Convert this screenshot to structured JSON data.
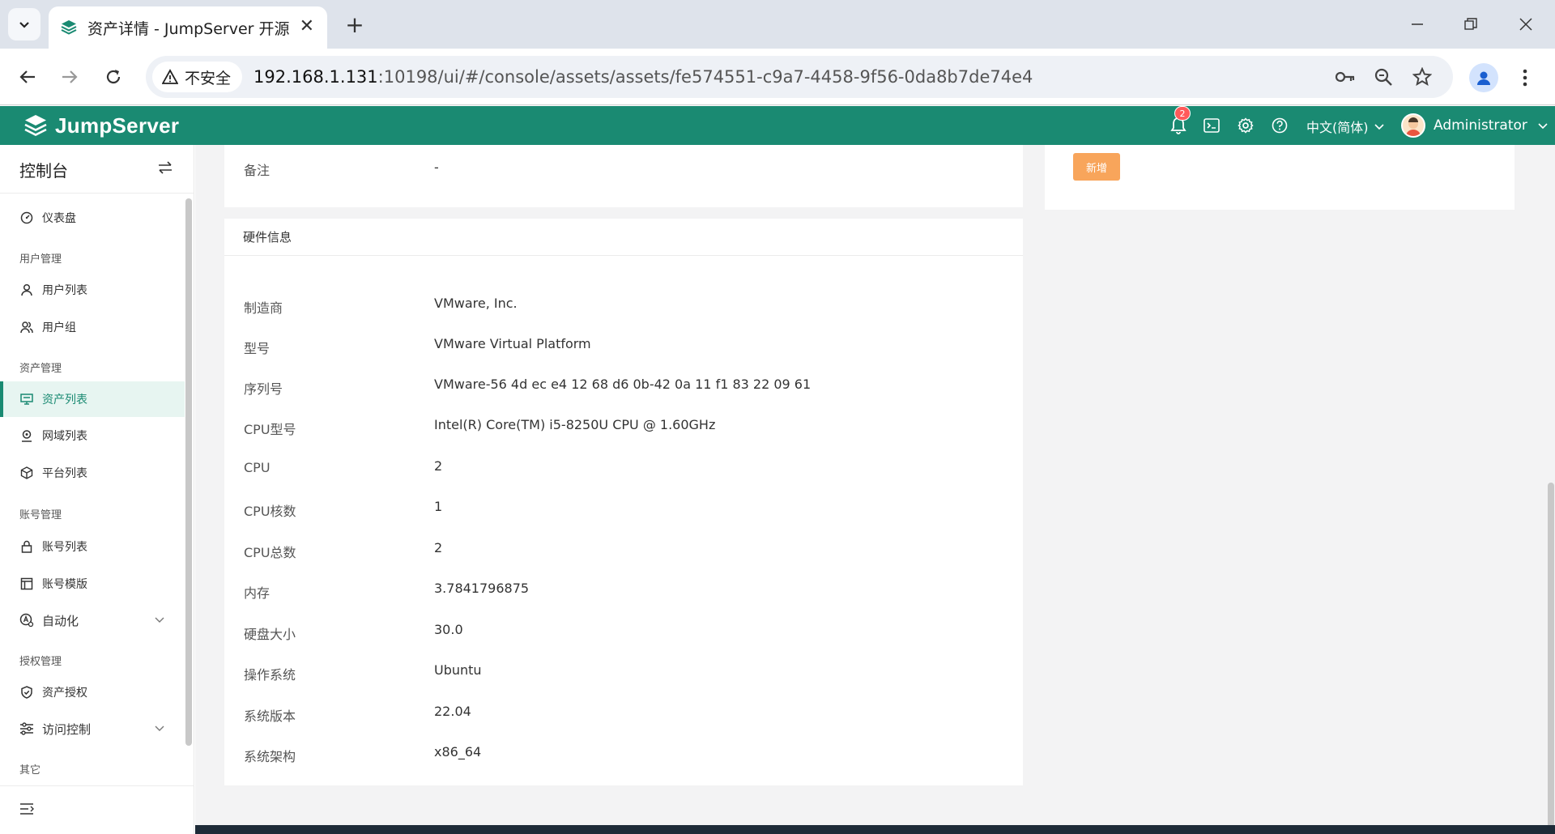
{
  "browser": {
    "tab_title": "资产详情 - JumpServer 开源堡垒机",
    "security_label": "不安全",
    "url_host": "192.168.1.131",
    "url_rest": ":10198/ui/#/console/assets/assets/fe574551-c9a7-4458-9f56-0da8b7de74e4"
  },
  "header": {
    "logo_text": "JumpServer",
    "notification_count": "2",
    "language": "中文(简体)",
    "username": "Administrator"
  },
  "sidebar": {
    "title": "控制台",
    "items": [
      {
        "label": "仪表盘",
        "icon": "dashboard-icon"
      },
      {
        "group": "用户管理"
      },
      {
        "label": "用户列表",
        "icon": "user-icon"
      },
      {
        "label": "用户组",
        "icon": "users-icon"
      },
      {
        "group": "资产管理"
      },
      {
        "label": "资产列表",
        "icon": "monitor-icon",
        "active": true
      },
      {
        "label": "网域列表",
        "icon": "location-icon"
      },
      {
        "label": "平台列表",
        "icon": "cube-icon"
      },
      {
        "group": "账号管理"
      },
      {
        "label": "账号列表",
        "icon": "lock-icon"
      },
      {
        "label": "账号模版",
        "icon": "template-icon"
      },
      {
        "label": "自动化",
        "icon": "automation-icon",
        "expandable": true
      },
      {
        "group": "授权管理"
      },
      {
        "label": "资产授权",
        "icon": "shield-icon"
      },
      {
        "label": "访问控制",
        "icon": "access-control-icon",
        "expandable": true
      },
      {
        "group": "其它"
      }
    ]
  },
  "main": {
    "top_card": {
      "key": "备注",
      "value": "-"
    },
    "right_card": {
      "add_button": "新增"
    },
    "hardware": {
      "title": "硬件信息",
      "rows": [
        {
          "key": "制造商",
          "value": "VMware, Inc."
        },
        {
          "key": "型号",
          "value": "VMware Virtual Platform"
        },
        {
          "key": "序列号",
          "value": "VMware-56 4d ec e4 12 68 d6 0b-42 0a 11 f1 83 22 09 61"
        },
        {
          "key": "CPU型号",
          "value": "Intel(R) Core(TM) i5-8250U CPU @ 1.60GHz"
        },
        {
          "key": "CPU",
          "value": "2"
        },
        {
          "key": "CPU核数",
          "value": "1"
        },
        {
          "key": "CPU总数",
          "value": "2"
        },
        {
          "key": "内存",
          "value": "3.7841796875"
        },
        {
          "key": "硬盘大小",
          "value": "30.0"
        },
        {
          "key": "操作系统",
          "value": "Ubuntu"
        },
        {
          "key": "系统版本",
          "value": "22.04"
        },
        {
          "key": "系统架构",
          "value": "x86_64"
        }
      ]
    }
  },
  "colors": {
    "brand": "#1a8a72",
    "add_button": "#f8a55b",
    "badge": "#ff5a5a"
  }
}
